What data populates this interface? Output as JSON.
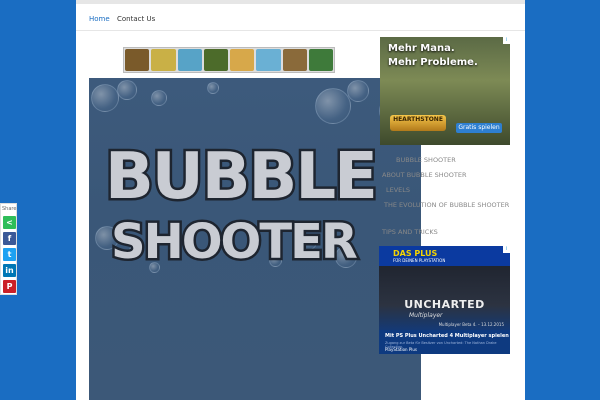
{
  "nav": {
    "items": [
      {
        "label": "Home",
        "active": true
      },
      {
        "label": "Contact Us",
        "active": false
      }
    ]
  },
  "game": {
    "logo_line1": "BUBBLE",
    "logo_line2": "SHOOTER"
  },
  "ads": {
    "sidebar_top": {
      "line1": "Mehr Mana.",
      "line2": "Mehr Probleme.",
      "brand": "HEARTHSTONE",
      "button": "Gratis spielen"
    },
    "sidebar_bottom": {
      "badge": "DAS PLUS",
      "badge_sub": "FÜR DEINEN PLAYSTATION",
      "title": "UNCHARTED",
      "subtitle": "Multiplayer",
      "beta": "Multiplayer Beta 4. – 13.12.2015",
      "cta": "Mit PS Plus Uncharted 4 Multiplayer spielen",
      "fine_print": "Zugang zur Beta für Besitzer von Uncharted: The Nathan Drake Collection",
      "brand": "PlayStation Plus"
    }
  },
  "sidebar": {
    "links": [
      "BUBBLE SHOOTER",
      "ABOUT BUBBLE SHOOTER",
      "LEVELS",
      "THE EVOLUTION OF BUBBLE SHOOTER",
      "TIPS AND TRICKS"
    ]
  },
  "share": {
    "label": "Share",
    "buttons": [
      {
        "icon": "share-icon",
        "color": "#2ebd59"
      },
      {
        "icon": "facebook-icon",
        "color": "#3b5998"
      },
      {
        "icon": "twitter-icon",
        "color": "#1da1f2"
      },
      {
        "icon": "linkedin-icon",
        "color": "#0077b5"
      },
      {
        "icon": "pinterest-icon",
        "color": "#cb2027"
      }
    ]
  },
  "colors": {
    "background": "#1a6dc2",
    "nav_active": "#1a6dc2"
  }
}
